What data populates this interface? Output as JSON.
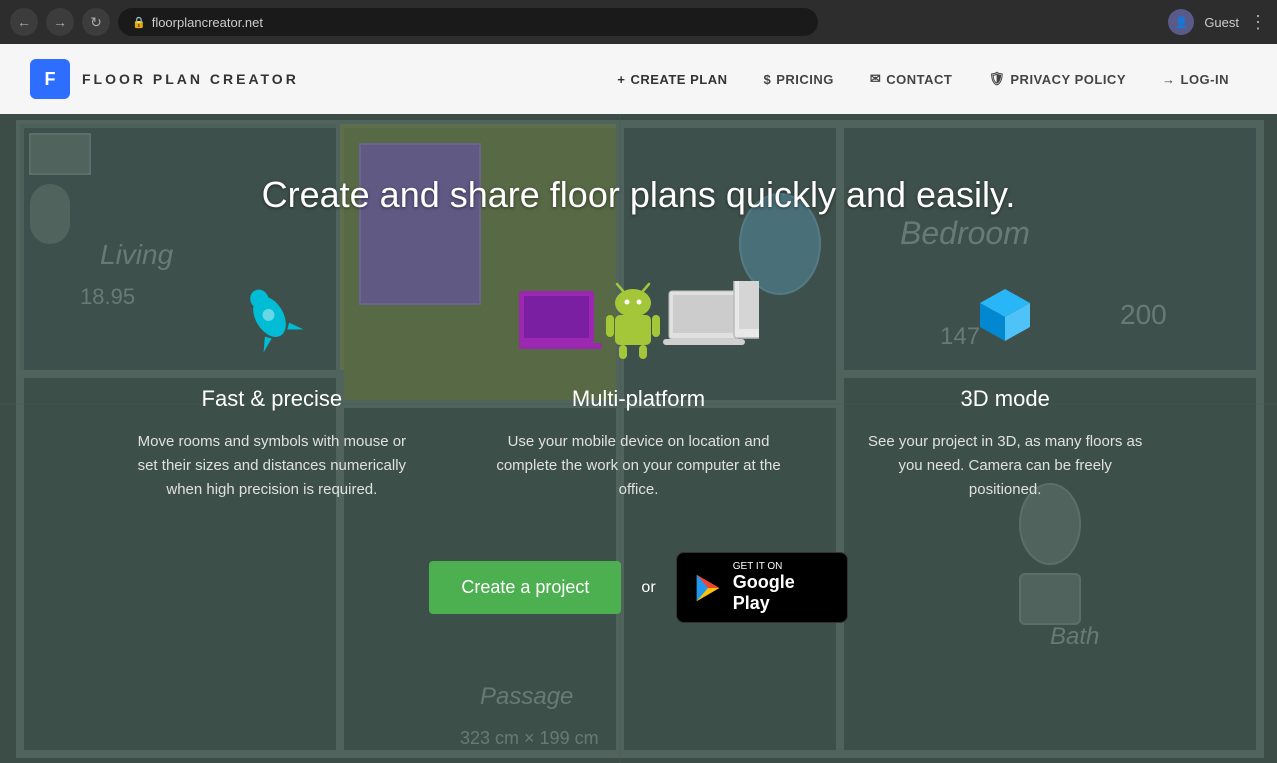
{
  "browser": {
    "url": "floorplancreator.net",
    "user": "Guest",
    "back_btn": "←",
    "forward_btn": "→",
    "refresh_btn": "↻"
  },
  "navbar": {
    "logo_letter": "F",
    "logo_text": "FLOOR PLAN CREATOR",
    "links": [
      {
        "id": "create-plan",
        "label": "CREATE PLAN",
        "icon": "+"
      },
      {
        "id": "pricing",
        "label": "PRICING",
        "icon": "$"
      },
      {
        "id": "contact",
        "label": "CONTACT",
        "icon": "✉"
      },
      {
        "id": "privacy-policy",
        "label": "PRIVACY POLICY",
        "icon": "🛡"
      },
      {
        "id": "log-in",
        "label": "LOG-IN",
        "icon": "→"
      }
    ]
  },
  "hero": {
    "title": "Create and share floor plans quickly and easily."
  },
  "features": [
    {
      "id": "fast-precise",
      "icon": "rocket",
      "title": "Fast & precise",
      "desc": "Move rooms and symbols with mouse or set their sizes and distances numerically when high precision is required."
    },
    {
      "id": "multi-platform",
      "icon": "multiplatform",
      "title": "Multi-platform",
      "desc": "Use your mobile device on location and complete the work on your computer at the office."
    },
    {
      "id": "3d-mode",
      "icon": "box3d",
      "title": "3D mode",
      "desc": "See your project in 3D, as many floors as you need. Camera can be freely positioned."
    }
  ],
  "cta": {
    "create_btn": "Create a project",
    "or_text": "or",
    "gplay_line1": "GET IT ON",
    "gplay_line2": "Google Play"
  }
}
